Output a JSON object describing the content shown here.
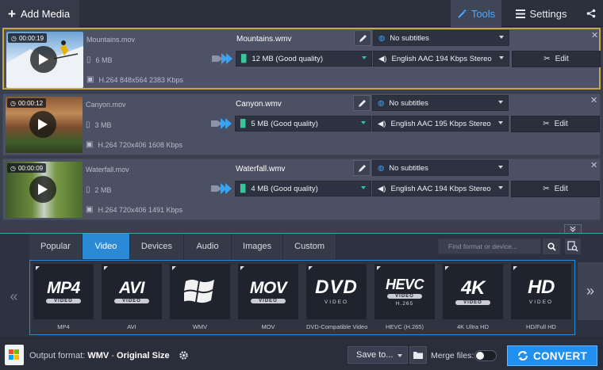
{
  "topbar": {
    "add_media": "Add Media",
    "tools": "Tools",
    "settings": "Settings"
  },
  "files": [
    {
      "duration": "00:00:19",
      "source_name": "Mountains.mov",
      "source_size": "6 MB",
      "source_codec": "H.264 848x564 2383 Kbps",
      "output_name": "Mountains.wmv",
      "output_size": "12 MB (Good quality)",
      "subtitles": "No subtitles",
      "audio": "English AAC 194 Kbps Stereo",
      "edit": "Edit",
      "selected": true
    },
    {
      "duration": "00:00:12",
      "source_name": "Canyon.mov",
      "source_size": "3 MB",
      "source_codec": "H.264 720x406 1608 Kbps",
      "output_name": "Canyon.wmv",
      "output_size": "5 MB (Good quality)",
      "subtitles": "No subtitles",
      "audio": "English AAC 195 Kbps Stereo",
      "edit": "Edit",
      "selected": false
    },
    {
      "duration": "00:00:09",
      "source_name": "Waterfall.mov",
      "source_size": "2 MB",
      "source_codec": "H.264 720x406 1491 Kbps",
      "output_name": "Waterfall.wmv",
      "output_size": "4 MB (Good quality)",
      "subtitles": "No subtitles",
      "audio": "English AAC 194 Kbps Stereo",
      "edit": "Edit",
      "selected": false
    }
  ],
  "tabs": [
    {
      "label": "Popular",
      "active": false
    },
    {
      "label": "Video",
      "active": true
    },
    {
      "label": "Devices",
      "active": false
    },
    {
      "label": "Audio",
      "active": false
    },
    {
      "label": "Images",
      "active": false
    },
    {
      "label": "Custom",
      "active": false
    }
  ],
  "search": {
    "placeholder": "Find format or device..."
  },
  "formats": [
    {
      "big": "MP4",
      "badge": "VIDEO",
      "label": "MP4"
    },
    {
      "big": "AVI",
      "badge": "VIDEO",
      "label": "AVI"
    },
    {
      "big": "",
      "badge": "",
      "label": "WMV",
      "icon": "windows-logo-icon"
    },
    {
      "big": "MOV",
      "badge": "VIDEO",
      "label": "MOV"
    },
    {
      "big": "DVD",
      "badge": "VIDEO",
      "label": "DVD-Compatible Video"
    },
    {
      "big": "HEVC",
      "badge": "H.265",
      "label": "HEVC (H.265)"
    },
    {
      "big": "4K",
      "badge": "VIDEO",
      "label": "4K Ultra HD"
    },
    {
      "big": "HD",
      "badge": "VIDEO",
      "label": "HD/Full HD"
    }
  ],
  "footer": {
    "output_prefix": "Output format:",
    "output_format": "WMV",
    "output_sep": " - ",
    "output_size": "Original Size",
    "save_to": "Save to...",
    "merge_files": "Merge files:",
    "convert": "CONVERT"
  },
  "colors": {
    "accent": "#2a8ad8",
    "selected_border": "#c6a747",
    "convert": "#1f8ff0",
    "dropdown_caret_teal": "#2dc3b3"
  }
}
